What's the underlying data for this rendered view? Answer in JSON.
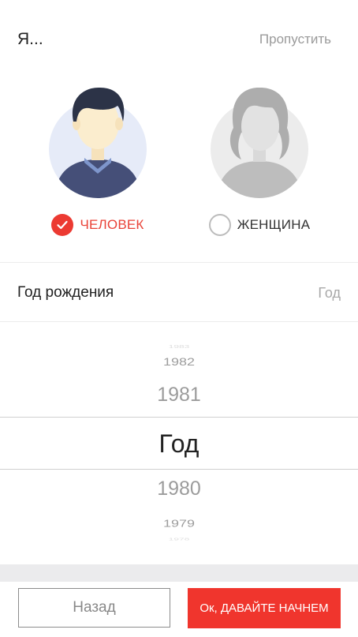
{
  "header": {
    "title": "Я...",
    "skip_label": "Пропустить"
  },
  "gender": {
    "options": [
      {
        "label": "ЧЕЛОВЕК",
        "selected": true,
        "icon": "male-avatar-icon"
      },
      {
        "label": "ЖЕНЩИНА",
        "selected": false,
        "icon": "female-avatar-icon"
      }
    ]
  },
  "birth_year": {
    "label": "Год рождения",
    "value_placeholder": "Год"
  },
  "picker": {
    "above": [
      "1982",
      "1981"
    ],
    "selected": "Год",
    "below": [
      "1980",
      "1979"
    ]
  },
  "footer": {
    "back_label": "Назад",
    "start_label": "Ок, ДАВАЙТЕ НАЧНЕМ"
  },
  "colors": {
    "accent": "#f0352d",
    "muted_text": "#9a9a9a"
  }
}
